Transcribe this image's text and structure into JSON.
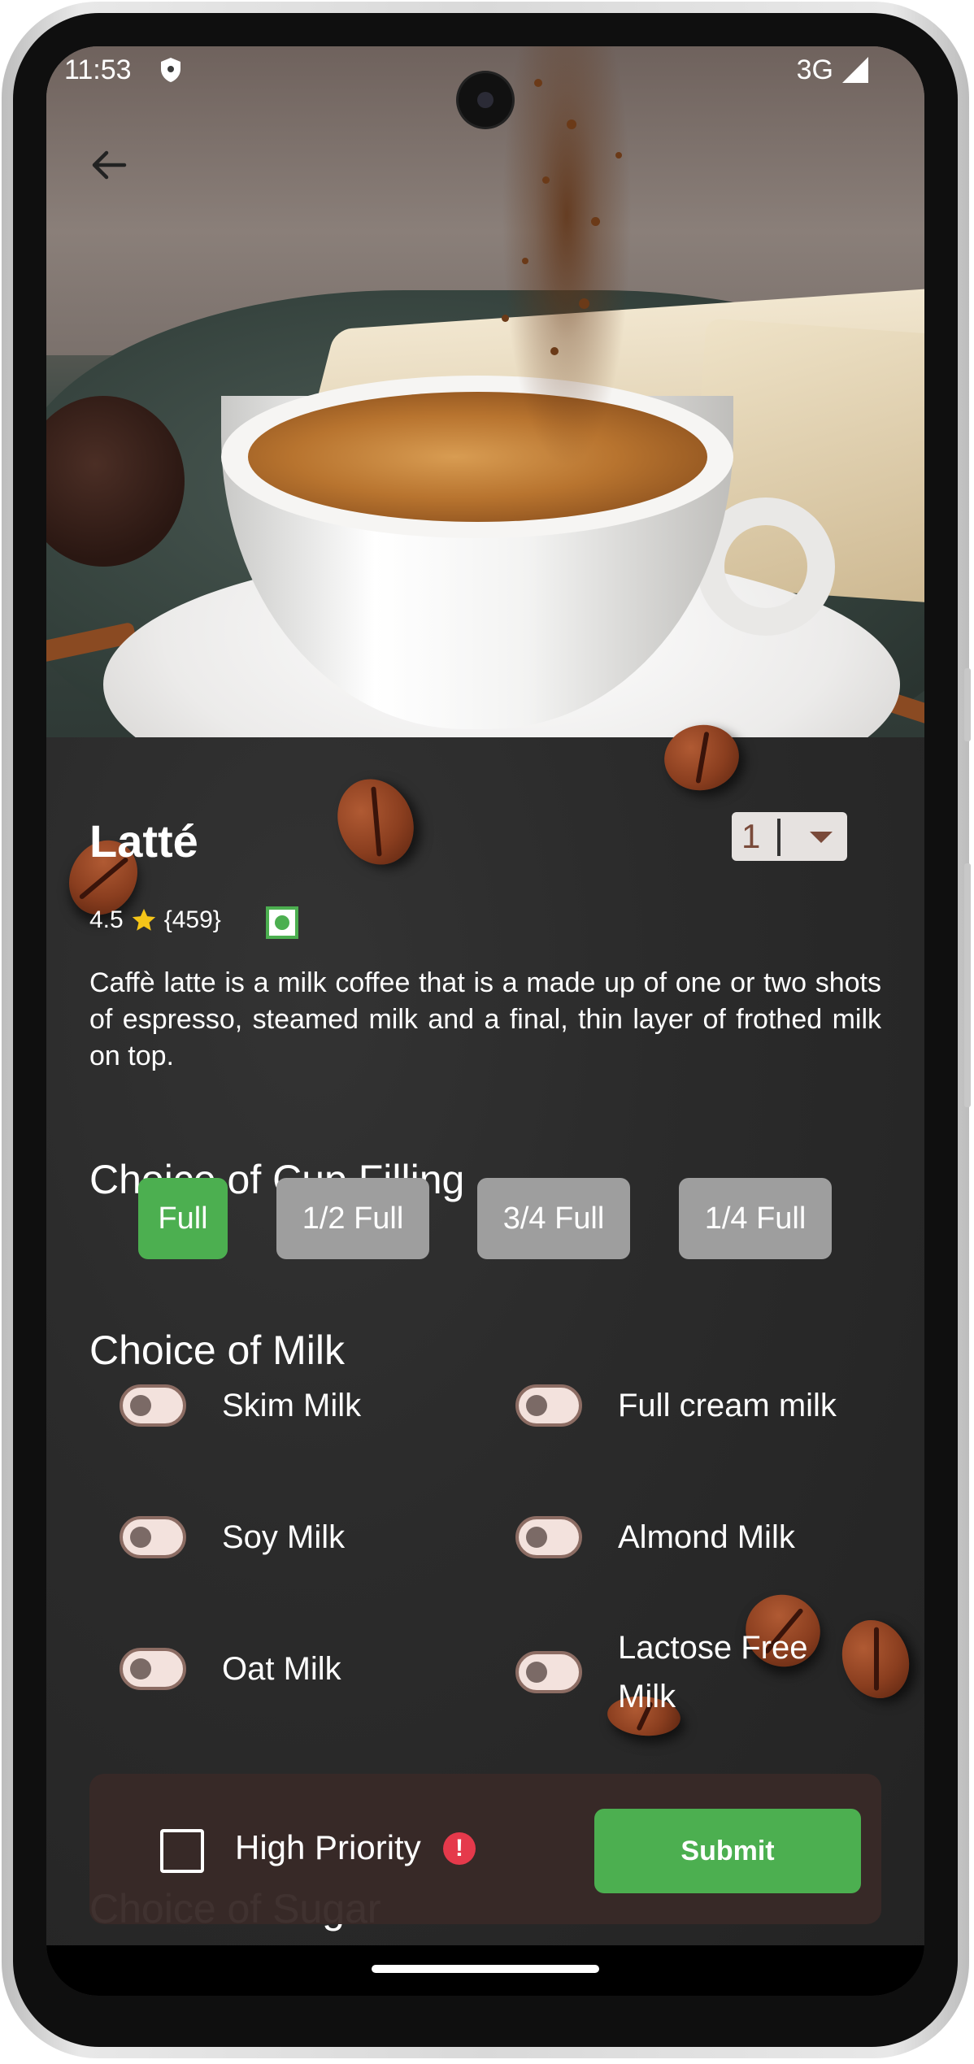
{
  "status_bar": {
    "time": "11:53",
    "network": "3G"
  },
  "product": {
    "name": "Latté",
    "quantity": "1",
    "rating": "4.5",
    "reviews": "{459}",
    "description": "Caffè latte is a milk coffee that is a made up of one or two shots of espresso, steamed milk and a final, thin layer of frothed milk on top."
  },
  "cup_filling": {
    "title": "Choice of Cup Filling",
    "options": [
      "Full",
      "1/2 Full",
      "3/4 Full",
      "1/4 Full"
    ],
    "selected": "Full"
  },
  "milk": {
    "title": "Choice of Milk",
    "options": [
      "Skim Milk",
      "Full cream milk",
      "Soy Milk",
      "Almond Milk",
      "Oat Milk",
      "Lactose Free Milk"
    ]
  },
  "sugar": {
    "title": "Choice of Sugar"
  },
  "footer": {
    "priority_label": "High Priority",
    "submit_label": "Submit"
  },
  "colors": {
    "accent": "#4caf50",
    "chip_inactive": "#9e9e9e",
    "alert": "#e5394b",
    "card": "#382a28"
  },
  "icons": [
    "back-arrow-icon",
    "shield-icon",
    "signal-icon",
    "star-icon",
    "veg-indicator-icon",
    "dropdown-caret-icon",
    "alert-icon"
  ]
}
